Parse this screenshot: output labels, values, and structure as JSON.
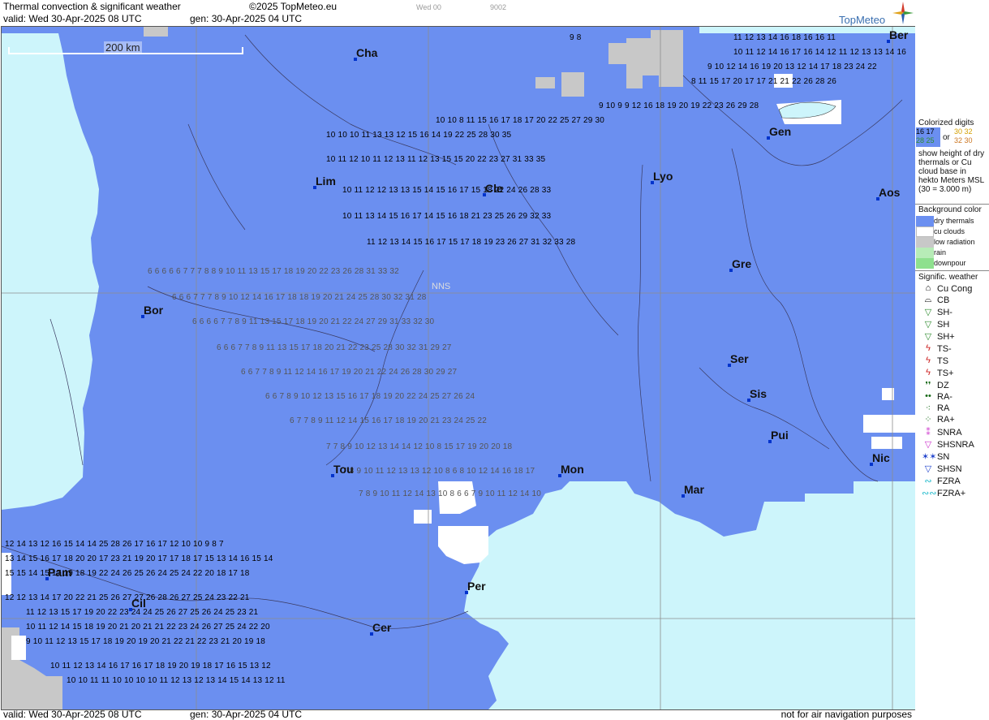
{
  "header": {
    "title": "Thermal convection & significant weather",
    "copyright": "©2025 TopMeteo.eu",
    "valid": "valid:  Wed  30-Apr-2025  08 UTC",
    "gen": "gen: 30-Apr-2025 04 UTC",
    "faint_left": "Wed 00",
    "faint_right": "9002",
    "brand": "TopMeteo"
  },
  "map": {
    "scale_label": "200 km",
    "center_label": "NNS",
    "cities": [
      {
        "name": "Cha"
      },
      {
        "name": "Lim"
      },
      {
        "name": "Cle"
      },
      {
        "name": "Lyo"
      },
      {
        "name": "Gen"
      },
      {
        "name": "Ber"
      },
      {
        "name": "Aos"
      },
      {
        "name": "Gre"
      },
      {
        "name": "Bor"
      },
      {
        "name": "Ser"
      },
      {
        "name": "Sis"
      },
      {
        "name": "Pui"
      },
      {
        "name": "Tou"
      },
      {
        "name": "Mon"
      },
      {
        "name": "Mar"
      },
      {
        "name": "Nic"
      },
      {
        "name": "Pam"
      },
      {
        "name": "Cil"
      },
      {
        "name": "Per"
      },
      {
        "name": "Cer"
      }
    ],
    "digit_rows": [
      {
        "text": "9  8",
        "color": "#000"
      },
      {
        "text": "11 12 13 14 16 18 16 16 11",
        "color": "#000"
      },
      {
        "text": "10 11 12 14 16 17 16 14 12 11 12 13 13 14 16",
        "color": "#000"
      },
      {
        "text": "9 10 12 14 16 19 20 13 12 14 17 18 23 24 22",
        "color": "#000"
      },
      {
        "text": "8 11 15 17 20 17 17 21 21 22 26 28 26",
        "color": "#000"
      },
      {
        "text": "9 10  9  9 12 16 18 19 20 19 22 23 26 29 28",
        "color": "#000"
      },
      {
        "text": "10 10  8  11 15 16 17 18 17 20 22 25 27 29 30",
        "color": "#000"
      },
      {
        "text": "10  10 10  11 13 13  12 15 16 14 19 22 25 28 30 35",
        "color": "#000"
      },
      {
        "text": "10 11 12 10 11 12 13 11 12 13 15 15 20 22 23 27 31 33 35",
        "color": "#000"
      },
      {
        "text": "10 11 12 12 13 13 15 14 15 16 17 15 18 22 24 26 28 33",
        "color": "#000"
      },
      {
        "text": "10 11 13 14 15 16 17 14 15 16 18 21 23 25 26 29 32 33",
        "color": "#000"
      },
      {
        "text": "11 12 13 14 15 16 17 15 17 18 19 23 26 27 31 32 33 28",
        "color": "#000"
      },
      {
        "text": "6  6  6  6  6  7  7  7  8  8  9  10 11 13 15 17 18 19 20 22 23 26 28 31 33 32",
        "color": "#555"
      },
      {
        "text": "6  6  6  7  7  7  8  9 10 12 14 16 17 18 18 19 20 21 24 25 28 30 32 31 28",
        "color": "#555"
      },
      {
        "text": "6  6  6  6  7  7  8  9 11 13 15 17 18 19 20 21 22 24 27 29 31 33 32 30",
        "color": "#555"
      },
      {
        "text": "6  6  6  7  7  8  9 11 13 15 17 18 20 21 22 23 25 28 30 32 31 29 27",
        "color": "#555"
      },
      {
        "text": "6  6  7  7  8  9 11 12 14 16 17 19 20 21 22 24 26 28 30 29 27",
        "color": "#555"
      },
      {
        "text": "6  6  7  8  9 10 12 13 15 16 17 18 19 20 22 24 25 27 26 24",
        "color": "#555"
      },
      {
        "text": "6  7  7  8  9 11 12 14 15 16 17 18 19 20 21 23 24 25 22",
        "color": "#555"
      },
      {
        "text": "7  7  8  9 10 12 13 14 14 12 10  8  15 17 19 20 20 18",
        "color": "#555"
      },
      {
        "text": "7  8  9 10 11 12 13 13 12 10  8   6  8 10 12 14 16 18 17",
        "color": "#555"
      },
      {
        "text": "7  8  9 10 11 12 14 13 10  8  6  6  7  9 10 11 12 14 10",
        "color": "#555"
      },
      {
        "text": "12 14 13 12 16 15 14 14 25 28 26 17 16 17 12 10  10  9  8  7",
        "color": "#000"
      },
      {
        "text": "13 14 15 16 17 18 20 20 17 23 21 19 20 17 17 18 17 15 13 14 16 15 14",
        "color": "#000"
      },
      {
        "text": "15 15 14 15 17 19 18 19 22 24 26 25 26 24 25 24 22 20 18 17 18",
        "color": "#000"
      },
      {
        "text": "12 12 13 14 17 20 22 21 25 26 27 27 26 28 26 27 25 24 23 22 21",
        "color": "#000"
      },
      {
        "text": "11 12 13 15 17 19 20 22 23 24 24 25 26 27 25 26 24 25 23 21",
        "color": "#000"
      },
      {
        "text": "10 11 12 14 15 18 19 20 21 20 21 21 22 23 24 26 27 25 24 22 20",
        "color": "#000"
      },
      {
        "text": "9 10 11 12 13 15 17 18 19 20 19 20 21 22 21 22 23 21 20 19 18",
        "color": "#000"
      },
      {
        "text": "10 11 12 13 14 16 17 16 17 18 19 20 19 18 17 16 15 13 12",
        "color": "#000"
      },
      {
        "text": "10 10 11 11 10 10 10 10 11 12 13 12 13 14 15 14 13 12 11",
        "color": "#000"
      }
    ]
  },
  "footer": {
    "valid": "valid:  Wed  30-Apr-2025  08 UTC",
    "gen": "gen: 30-Apr-2025 04 UTC",
    "disclaimer": "not for air navigation purposes"
  },
  "legend": {
    "intro": "Colorized digits",
    "sample_a": "16 17",
    "sample_b": "28 25",
    "or": "or",
    "sample_c": "30 32",
    "sample_d": "32 30",
    "desc": "show height of dry thermals or Cu cloud base in hekto Meters MSL (30 = 3.000 m)",
    "background_header": "Background color",
    "backgrounds": [
      {
        "label": "dry thermals",
        "color": "#6b8ff0"
      },
      {
        "label": "cu clouds",
        "color": "#ffffff"
      },
      {
        "label": "low radiation",
        "color": "#c8c8c8"
      },
      {
        "label": "rain",
        "color": "#b7ecb7"
      },
      {
        "label": "downpour",
        "color": "#8ee08e"
      }
    ],
    "weather_header": "Signific. weather",
    "weather": [
      {
        "label": "Cu Cong",
        "symbol": "cu-cong-icon",
        "glyph": "⌂",
        "color": "#000"
      },
      {
        "label": "CB",
        "symbol": "cb-icon",
        "glyph": "⌓",
        "color": "#000"
      },
      {
        "label": "SH-",
        "symbol": "shower-light-icon",
        "glyph": "▽",
        "color": "#2e8b2e"
      },
      {
        "label": "SH",
        "symbol": "shower-icon",
        "glyph": "▽",
        "color": "#2e8b2e"
      },
      {
        "label": "SH+",
        "symbol": "shower-heavy-icon",
        "glyph": "▽",
        "color": "#2e8b2e"
      },
      {
        "label": "TS-",
        "symbol": "thunderstorm-light-icon",
        "glyph": "ϟ",
        "color": "#cc2222"
      },
      {
        "label": "TS",
        "symbol": "thunderstorm-icon",
        "glyph": "ϟ",
        "color": "#cc2222"
      },
      {
        "label": "TS+",
        "symbol": "thunderstorm-heavy-icon",
        "glyph": "ϟ",
        "color": "#cc2222"
      },
      {
        "label": "DZ",
        "symbol": "drizzle-icon",
        "glyph": "❜❜",
        "color": "#1a6b1a"
      },
      {
        "label": "RA-",
        "symbol": "rain-light-icon",
        "glyph": "••",
        "color": "#1a6b1a"
      },
      {
        "label": "RA",
        "symbol": "rain-icon",
        "glyph": "⁖",
        "color": "#1a6b1a"
      },
      {
        "label": "RA+",
        "symbol": "rain-heavy-icon",
        "glyph": "⁘",
        "color": "#1a6b1a"
      },
      {
        "label": "SNRA",
        "symbol": "snow-rain-icon",
        "glyph": "⁑",
        "color": "#cc33cc"
      },
      {
        "label": "SHSNRA",
        "symbol": "snow-rain-shower-icon",
        "glyph": "▽",
        "color": "#cc33cc"
      },
      {
        "label": "SN",
        "symbol": "snow-icon",
        "glyph": "✶✶",
        "color": "#2244cc"
      },
      {
        "label": "SHSN",
        "symbol": "snow-shower-icon",
        "glyph": "▽",
        "color": "#2244cc"
      },
      {
        "label": "FZRA",
        "symbol": "freezing-rain-icon",
        "glyph": "∾",
        "color": "#22bbcc"
      },
      {
        "label": "FZRA+",
        "symbol": "freezing-rain-heavy-icon",
        "glyph": "∾∾",
        "color": "#22bbcc"
      }
    ]
  }
}
